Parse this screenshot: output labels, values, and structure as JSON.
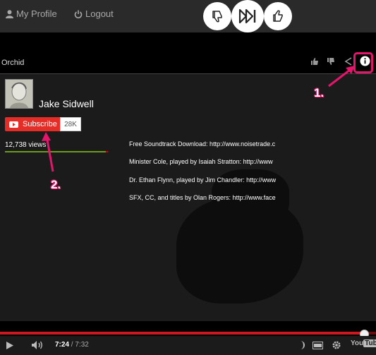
{
  "topbar": {
    "my_profile": "My Profile",
    "logout": "Logout",
    "buttons": [
      "thumbs-down",
      "skip-forward",
      "thumbs-up"
    ]
  },
  "video": {
    "title": "Orchid",
    "title_icons": [
      "thumbs-up-icon",
      "thumbs-down-icon",
      "share-icon",
      "info-icon"
    ]
  },
  "channel": {
    "name": "Jake Sidwell",
    "subscribe_label": "Subscribe",
    "subscriber_count": "28K",
    "views": "12,738 views"
  },
  "description": [
    "Free Soundtrack Download: http://www.noisetrade.c",
    "Minister Cole, played by Isaiah Stratton: http://www",
    "Dr. Ethan Flynn, played by Jim Chandler: http://www",
    "SFX, CC, and titles by Olan Rogers: http://www.face"
  ],
  "annotations": {
    "one": "1.",
    "two": "2."
  },
  "controls": {
    "current_time": "7:24",
    "separator": " / ",
    "duration": "7:32",
    "progress": 0.968,
    "logo_you": "You",
    "logo_tube": "Tube"
  },
  "colors": {
    "accent": "#e5156b",
    "youtube_red": "#cc181e",
    "subscribe_red": "#e52d27"
  }
}
